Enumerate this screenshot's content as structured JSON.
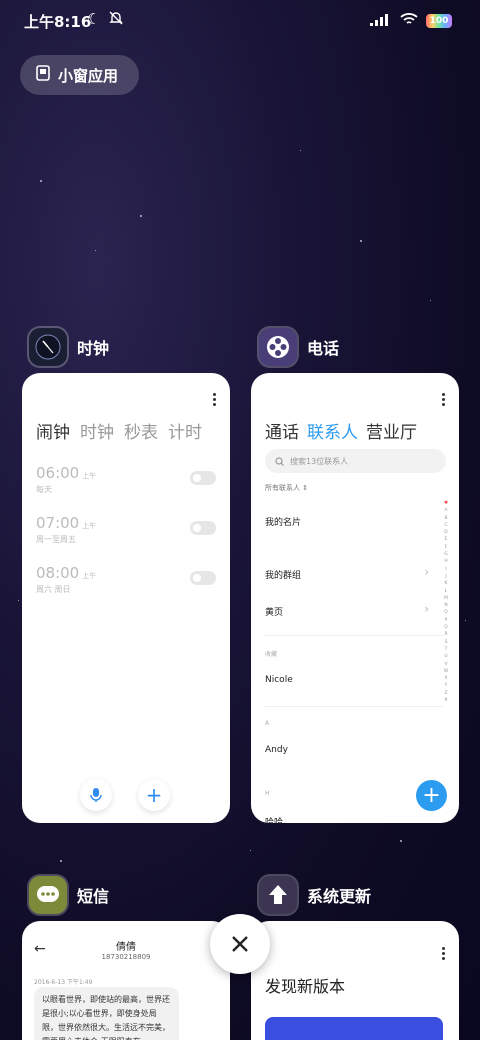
{
  "status_bar": {
    "time": "上午8:16",
    "battery": "100",
    "icons_left": [
      "moon-icon",
      "bell-off-icon"
    ],
    "icons_right": [
      "signal-icon",
      "wifi-icon",
      "battery-icon"
    ]
  },
  "small_window": {
    "label": "小窗应用",
    "icon": "small-window-icon"
  },
  "apps": {
    "clock": {
      "name": "时钟",
      "tabs": [
        "闹钟",
        "时钟",
        "秒表",
        "计时"
      ],
      "alarms": [
        {
          "time": "06:00",
          "ampm": "上午",
          "repeat": "每天"
        },
        {
          "time": "07:00",
          "ampm": "上午",
          "repeat": "周一至周五"
        },
        {
          "time": "08:00",
          "ampm": "上午",
          "repeat": "周六 周日"
        }
      ],
      "add_label": "+"
    },
    "phone": {
      "name": "电话",
      "tabs": [
        "通话",
        "联系人",
        "营业厅"
      ],
      "search_placeholder": "搜索13位联系人",
      "filter": "所有联系人 ⇕",
      "my_card": "我的名片",
      "groups": "我的群组",
      "yellow_pages": "黄页",
      "section_favorites": "收藏",
      "favorite_1": "Nicole",
      "section_a": "A",
      "contact_a": "Andy",
      "section_h": "H",
      "contact_h": "哈哈",
      "index_letters": [
        "♥",
        "A",
        "B",
        "C",
        "D",
        "E",
        "F",
        "G",
        "H",
        "I",
        "J",
        "K",
        "L",
        "M",
        "N",
        "O",
        "P",
        "Q",
        "R",
        "S",
        "T",
        "U",
        "V",
        "W",
        "X",
        "Y",
        "Z",
        "#"
      ],
      "fab": "+"
    },
    "sms": {
      "name": "短信",
      "contact_name": "倩倩",
      "contact_number": "18730218809",
      "date": "2016-6-13 下午1:49",
      "message": "以眼看世界，即使站的最高，世界还是很小;以心看世界，即使身处局限，世界依然很大。生活远不完美，需要用心去体会;无限阳春在..."
    },
    "update": {
      "name": "系统更新",
      "title": "发现新版本"
    }
  },
  "close_label": "✕"
}
